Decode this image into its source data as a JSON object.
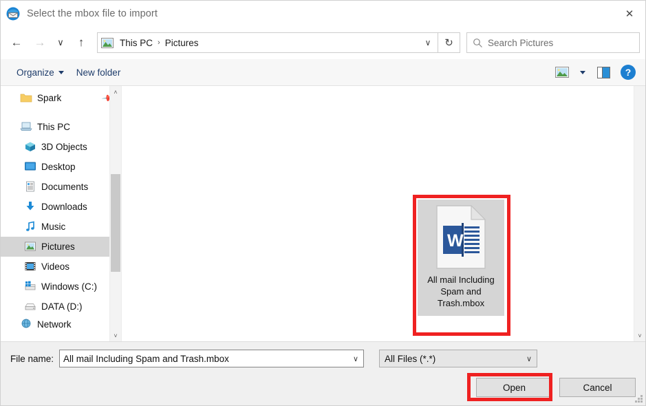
{
  "window": {
    "title": "Select the mbox file to import",
    "app_icon": "thunderbird-icon",
    "close_label": "✕"
  },
  "nav": {
    "back": "←",
    "forward": "→",
    "recent": "∨",
    "up": "↑",
    "refresh": "↻",
    "address_chevron": "∨",
    "breadcrumb_icon": "pictures-folder-icon",
    "breadcrumbs": [
      "This PC",
      "Pictures"
    ],
    "separator": "›"
  },
  "search": {
    "icon": "search-icon",
    "placeholder": "Search Pictures",
    "value": ""
  },
  "toolbar": {
    "organize_label": "Organize",
    "new_folder_label": "New folder",
    "view_icon": "view-layout-icon",
    "view_chevron": "▾",
    "preview_pane_icon": "preview-pane-icon",
    "help_label": "?"
  },
  "sidebar": {
    "items": [
      {
        "label": "Spark",
        "icon": "folder-icon",
        "indent": 1,
        "pinned": true,
        "selected": false
      },
      {
        "label": "This PC",
        "icon": "this-pc-icon",
        "indent": 1,
        "pinned": false,
        "selected": false
      },
      {
        "label": "3D Objects",
        "icon": "3d-objects-icon",
        "indent": 2,
        "pinned": false,
        "selected": false
      },
      {
        "label": "Desktop",
        "icon": "desktop-icon",
        "indent": 2,
        "pinned": false,
        "selected": false
      },
      {
        "label": "Documents",
        "icon": "documents-icon",
        "indent": 2,
        "pinned": false,
        "selected": false
      },
      {
        "label": "Downloads",
        "icon": "downloads-icon",
        "indent": 2,
        "pinned": false,
        "selected": false
      },
      {
        "label": "Music",
        "icon": "music-icon",
        "indent": 2,
        "pinned": false,
        "selected": false
      },
      {
        "label": "Pictures",
        "icon": "pictures-icon",
        "indent": 2,
        "pinned": false,
        "selected": true
      },
      {
        "label": "Videos",
        "icon": "videos-icon",
        "indent": 2,
        "pinned": false,
        "selected": false
      },
      {
        "label": "Windows (C:)",
        "icon": "windows-drive-icon",
        "indent": 2,
        "pinned": false,
        "selected": false
      },
      {
        "label": "DATA (D:)",
        "icon": "drive-icon",
        "indent": 2,
        "pinned": false,
        "selected": false
      },
      {
        "label": "Network",
        "icon": "network-icon",
        "indent": 1,
        "pinned": false,
        "selected": false
      }
    ],
    "scroll_up": "˄",
    "scroll_down": "˅"
  },
  "main": {
    "file": {
      "name": "All mail Including Spam and Trash.mbox",
      "icon": "word-document-icon",
      "selected": true,
      "highlighted": true
    },
    "scroll_down": "˅"
  },
  "footer": {
    "file_name_label": "File name:",
    "file_name_value": "All mail Including Spam and Trash.mbox",
    "file_name_placeholder": "File name",
    "combo_arrow": "∨",
    "filter_value": "All Files (*.*)",
    "filter_arrow": "∨",
    "open_label": "Open",
    "cancel_label": "Cancel"
  },
  "colors": {
    "accent": "#0078d7",
    "highlight_red": "#ef2121",
    "selection_gray": "#d5d5d5",
    "word_blue": "#2b579a"
  }
}
